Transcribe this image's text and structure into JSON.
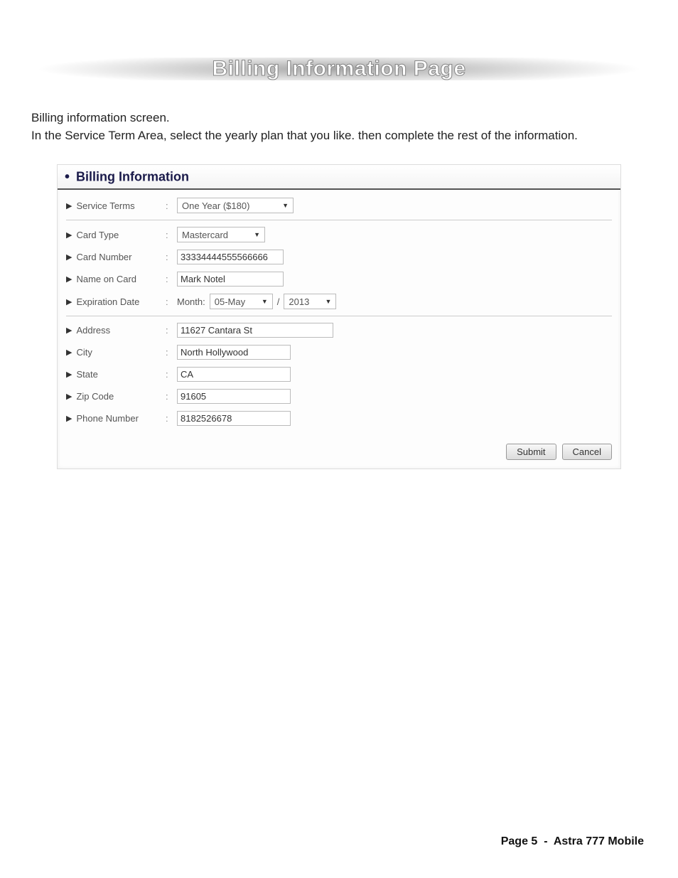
{
  "title": "Billing Information Page",
  "intro_line1": "Billing information screen.",
  "intro_line2": "In the Service Term Area, select the yearly plan that you like. then complete the rest of the information.",
  "section_header": "Billing Information",
  "form": {
    "service_terms": {
      "label": "Service Terms",
      "value": "One Year ($180)"
    },
    "card_type": {
      "label": "Card Type",
      "value": "Mastercard"
    },
    "card_number": {
      "label": "Card Number",
      "value": "33334444555566666"
    },
    "name_on_card": {
      "label": "Name on Card",
      "value": "Mark Notel"
    },
    "expiration": {
      "label": "Expiration Date",
      "month_prefix": "Month:",
      "month": "05-May",
      "sep": "/",
      "year": "2013"
    },
    "address": {
      "label": "Address",
      "value": "11627 Cantara St"
    },
    "city": {
      "label": "City",
      "value": "North Hollywood"
    },
    "state": {
      "label": "State",
      "value": "CA"
    },
    "zip": {
      "label": "Zip Code",
      "value": "91605"
    },
    "phone": {
      "label": "Phone Number",
      "value": "8182526678"
    }
  },
  "buttons": {
    "submit": "Submit",
    "cancel": "Cancel"
  },
  "footer": {
    "page_label": "Page 5",
    "dash": "-",
    "doc": "Astra 777 Mobile"
  }
}
